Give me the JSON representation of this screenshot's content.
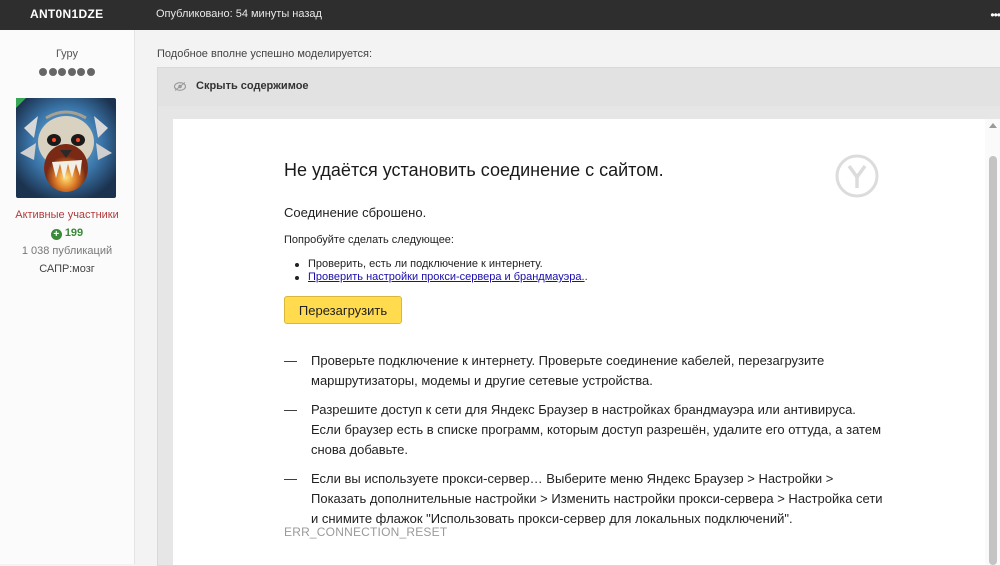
{
  "topbar": {
    "username": "ANT0N1DZE",
    "published": "Опубликовано: 54 минуты назад",
    "menu_icon": "dots-icon"
  },
  "author": {
    "rank_title": "Гуру",
    "rank_pips": 6,
    "avatar_icon": "skull-avatar",
    "member_group": "Активные участники",
    "reputation": "199",
    "posts": "1 038 публикаций",
    "custom_field": "САПР:мозг",
    "colors": {
      "group": "#b23b3b",
      "reputation": "#3a8a3a"
    }
  },
  "post": {
    "intro": "Подобное вполне успешно моделируется:",
    "spoiler_label": "Скрыть содержимое",
    "spoiler_icon": "eye-icon"
  },
  "error_page": {
    "title": "Не удаётся установить соединение с сайтом.",
    "subtitle": "Соединение сброшено.",
    "try_label": "Попробуйте сделать следующее:",
    "suggestions": [
      "Проверить, есть ли подключение к интернету.",
      "Проверить настройки прокси-сервера и брандмауэра."
    ],
    "suggestion_link_suffix": ".",
    "reload_button": "Перезагрузить",
    "dash": "—",
    "details": [
      "Проверьте подключение к интернету. Проверьте соединение кабелей, перезагрузите маршрутизаторы, модемы и другие сетевые устройства.",
      "Разрешите доступ к сети для Яндекс Браузер в настройках брандмауэра или антивируса. Если браузер есть в списке программ, которым доступ разрешён, удалите его оттуда, а затем снова добавьте.",
      "Если вы используете прокси-сервер… Выберите меню Яндекс Браузер > Настройки > Показать дополнительные настройки > Изменить настройки прокси-сервера > Настройка сети и снимите флажок \"Использовать прокси-сервер для локальных подключений\"."
    ],
    "error_code": "ERR_CONNECTION_RESET",
    "logo_icon": "yandex-browser-icon",
    "colors": {
      "button": "#ffdb4d",
      "link": "#1a0dab",
      "code": "#9a9a9a"
    }
  }
}
